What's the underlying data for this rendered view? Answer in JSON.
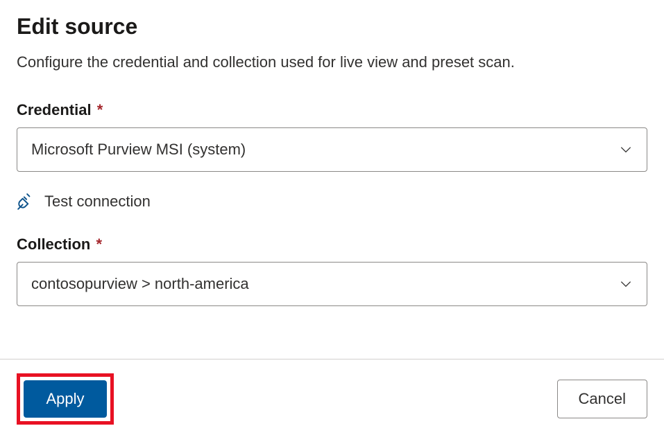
{
  "header": {
    "title": "Edit source",
    "description": "Configure the credential and collection used for live view and preset scan."
  },
  "fields": {
    "credential": {
      "label": "Credential",
      "required_marker": "*",
      "value": "Microsoft Purview MSI (system)"
    },
    "collection": {
      "label": "Collection",
      "required_marker": "*",
      "value": "contosopurview > north-america"
    }
  },
  "actions": {
    "test_connection": "Test connection",
    "apply": "Apply",
    "cancel": "Cancel"
  }
}
